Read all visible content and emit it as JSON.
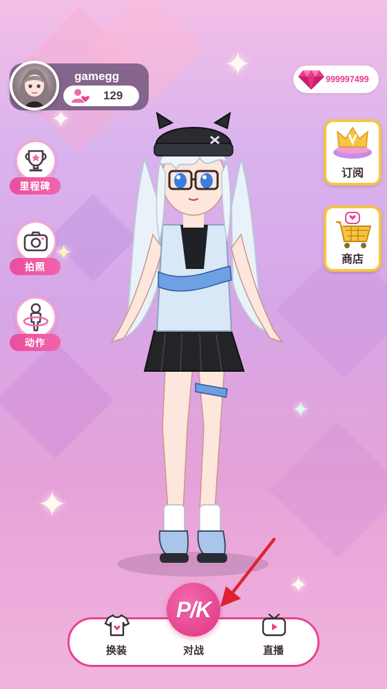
{
  "profile": {
    "username": "gamegg",
    "likes": "129"
  },
  "currency": {
    "gems": "999997499"
  },
  "left_menu": [
    {
      "label": "里程碑",
      "icon": "trophy-icon"
    },
    {
      "label": "拍照",
      "icon": "camera-icon"
    },
    {
      "label": "动作",
      "icon": "pose-icon"
    }
  ],
  "right_menu": [
    {
      "label": "订阅",
      "icon": "crown-icon"
    },
    {
      "label": "商店",
      "icon": "shopping-cart-icon"
    }
  ],
  "bottom_nav": {
    "dress_up": "换装",
    "battle": "对战",
    "pk_button": "P/K",
    "live": "直播"
  },
  "colors": {
    "accent": "#e5438e",
    "gold": "#f7c442",
    "gem_text": "#e83a8a"
  }
}
